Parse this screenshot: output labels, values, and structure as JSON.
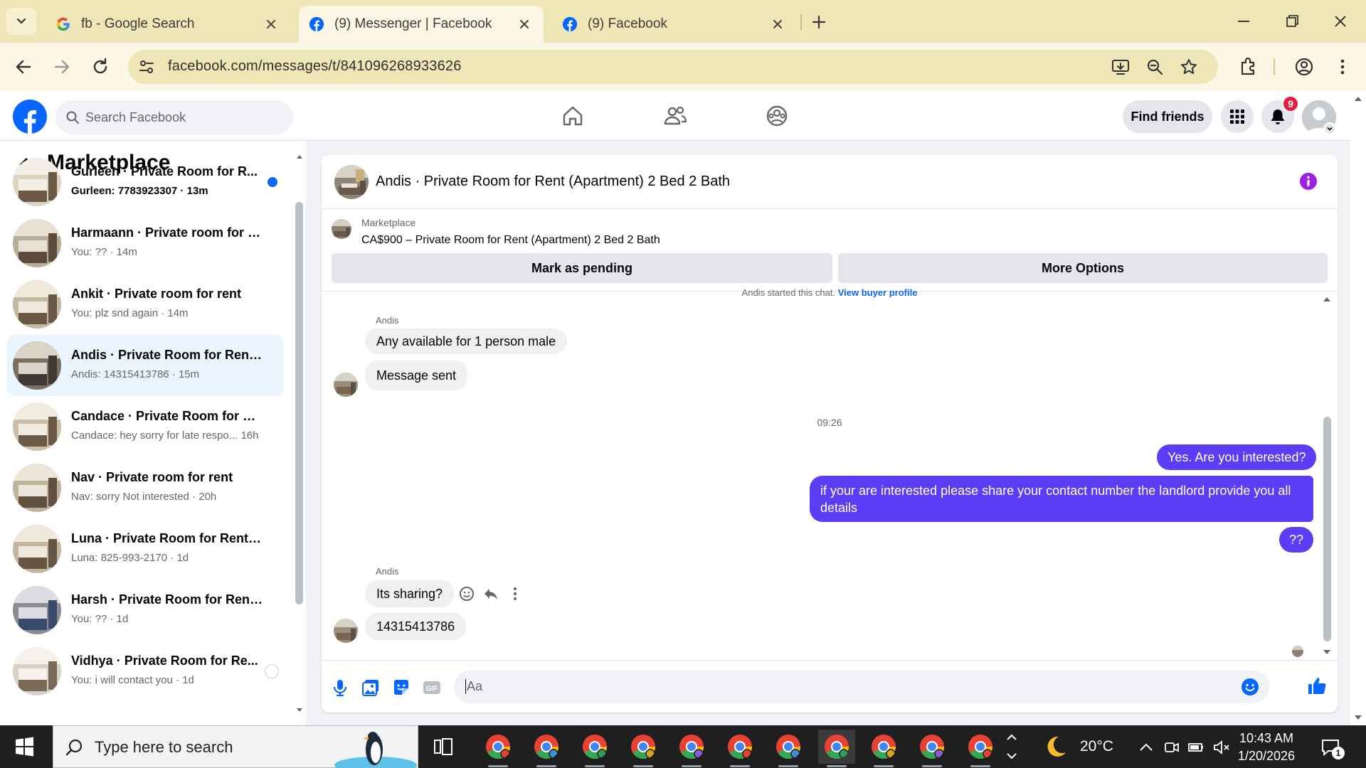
{
  "browser": {
    "tabs": [
      {
        "title": "fb - Google Search",
        "favicon": "google-icon",
        "active": false
      },
      {
        "title": "(9) Messenger | Facebook",
        "favicon": "facebook-icon",
        "active": true
      },
      {
        "title": "(9) Facebook",
        "favicon": "facebook-icon",
        "active": false
      }
    ],
    "url": "facebook.com/messages/t/841096268933626"
  },
  "header": {
    "search_placeholder": "Search Facebook",
    "find_friends": "Find friends",
    "notification_count": "9",
    "brand_color": "#0866ff"
  },
  "sidebar": {
    "title": "Marketplace",
    "conversations": [
      {
        "title": "Gurleen · Private Room for R...",
        "subtitle": "Gurleen: 7783923307 · 13m",
        "unread": true
      },
      {
        "title": "Harmaann · Private room for re...",
        "subtitle": "You: ?? · 14m",
        "unread": false
      },
      {
        "title": "Ankit · Private room for rent",
        "subtitle": "You: plz snd again · 14m",
        "unread": false
      },
      {
        "title": "Andis · Private Room for Rent (...",
        "subtitle": "Andis: 14315413786 · 15m",
        "unread": false,
        "selected": true
      },
      {
        "title": "Candace · Private Room for Re...",
        "subtitle": "Candace: hey sorry for late respo...  16h",
        "unread": false
      },
      {
        "title": "Nav · Private room for rent",
        "subtitle": "Nav: sorry Not interested · 20h",
        "unread": false
      },
      {
        "title": "Luna · Private Room for Rent (...",
        "subtitle": "Luna: 825-993-2170 · 1d",
        "unread": false
      },
      {
        "title": "Harsh · Private Room for Rent (...",
        "subtitle": "You: ?? · 1d",
        "unread": false
      },
      {
        "title": "Vidhya · Private Room for Re...",
        "subtitle": "You: i will contact you · 1d",
        "unread": false
      }
    ]
  },
  "chat": {
    "title": "Andis · Private Room for Rent (Apartment) 2 Bed 2 Bath",
    "listing_label": "Marketplace",
    "listing_price": "CA$900 – Private Room for Rent (Apartment) 2 Bed 2 Bath",
    "mark_pending": "Mark as pending",
    "more_options": "More Options",
    "started_text": "Andis started this chat.",
    "started_link": "View buyer profile",
    "sender_name": "Andis",
    "messages_in_1": [
      "Any available for 1 person male",
      "Message sent"
    ],
    "timestamp": "09:26",
    "messages_out": [
      "Yes. Are you interested?",
      "if your are interested please share your contact number the landlord provide you all details",
      "??"
    ],
    "messages_in_2": [
      "Its sharing?",
      "14315413786"
    ],
    "composer_placeholder": "Aa",
    "accent_color": "#5b3df5"
  },
  "taskbar": {
    "search_placeholder": "Type here to search",
    "temperature": "20°C",
    "time": "10:43 AM",
    "date": "1/20/2026",
    "notification_count": "1"
  }
}
